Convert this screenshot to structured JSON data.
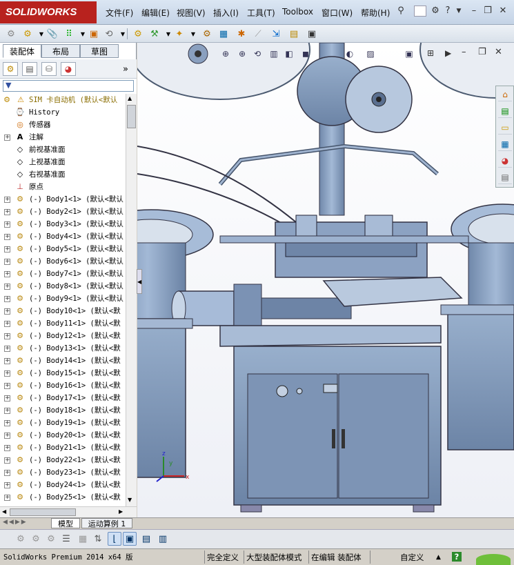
{
  "app": {
    "logo": "SOLIDWORKS"
  },
  "menu": [
    "文件(F)",
    "编辑(E)",
    "视图(V)",
    "插入(I)",
    "工具(T)",
    "Toolbox",
    "窗口(W)",
    "帮助(H)"
  ],
  "panel_tabs": [
    "装配体",
    "布局",
    "草图"
  ],
  "panel_collapse": "»",
  "filter_symbol": "▼",
  "tree": {
    "root": "SIM 卡自动机  (默认<默认",
    "fixed": [
      "History",
      "传感器",
      "注解",
      "前视基准面",
      "上视基准面",
      "右视基准面",
      "原点"
    ],
    "bodies": [
      "(-) Body1<1> (默认<默认",
      "(-) Body2<1> (默认<默认",
      "(-) Body3<1> (默认<默认",
      "(-) Body4<1> (默认<默认",
      "(-) Body5<1> (默认<默认",
      "(-) Body6<1> (默认<默认",
      "(-) Body7<1> (默认<默认",
      "(-) Body8<1> (默认<默认",
      "(-) Body9<1> (默认<默认",
      "(-) Body10<1> (默认<默",
      "(-) Body11<1> (默认<默",
      "(-) Body12<1> (默认<默",
      "(-) Body13<1> (默认<默",
      "(-) Body14<1> (默认<默",
      "(-) Body15<1> (默认<默",
      "(-) Body16<1> (默认<默",
      "(-) Body17<1> (默认<默",
      "(-) Body18<1> (默认<默",
      "(-) Body19<1> (默认<默",
      "(-) Body20<1> (默认<默",
      "(-) Body21<1> (默认<默",
      "(-) Body22<1> (默认<默",
      "(-) Body23<1> (默认<默",
      "(-) Body24<1> (默认<默",
      "(-) Body25<1> (默认<默"
    ]
  },
  "bottom_tabs": [
    "模型",
    "运动算例 1"
  ],
  "status": {
    "version": "SolidWorks Premium 2014 x64 版",
    "s1": "完全定义",
    "s2": "大型装配体模式",
    "s3": "在编辑 装配体",
    "s4": "自定义",
    "s4_arrow": "▲",
    "help": "?"
  },
  "colors": {
    "model_blue": "#8aa3c3",
    "logo_red": "#b8221e",
    "accent": "#7f9db9"
  },
  "axis_labels": {
    "x": "x",
    "y": "y",
    "z": "z"
  }
}
